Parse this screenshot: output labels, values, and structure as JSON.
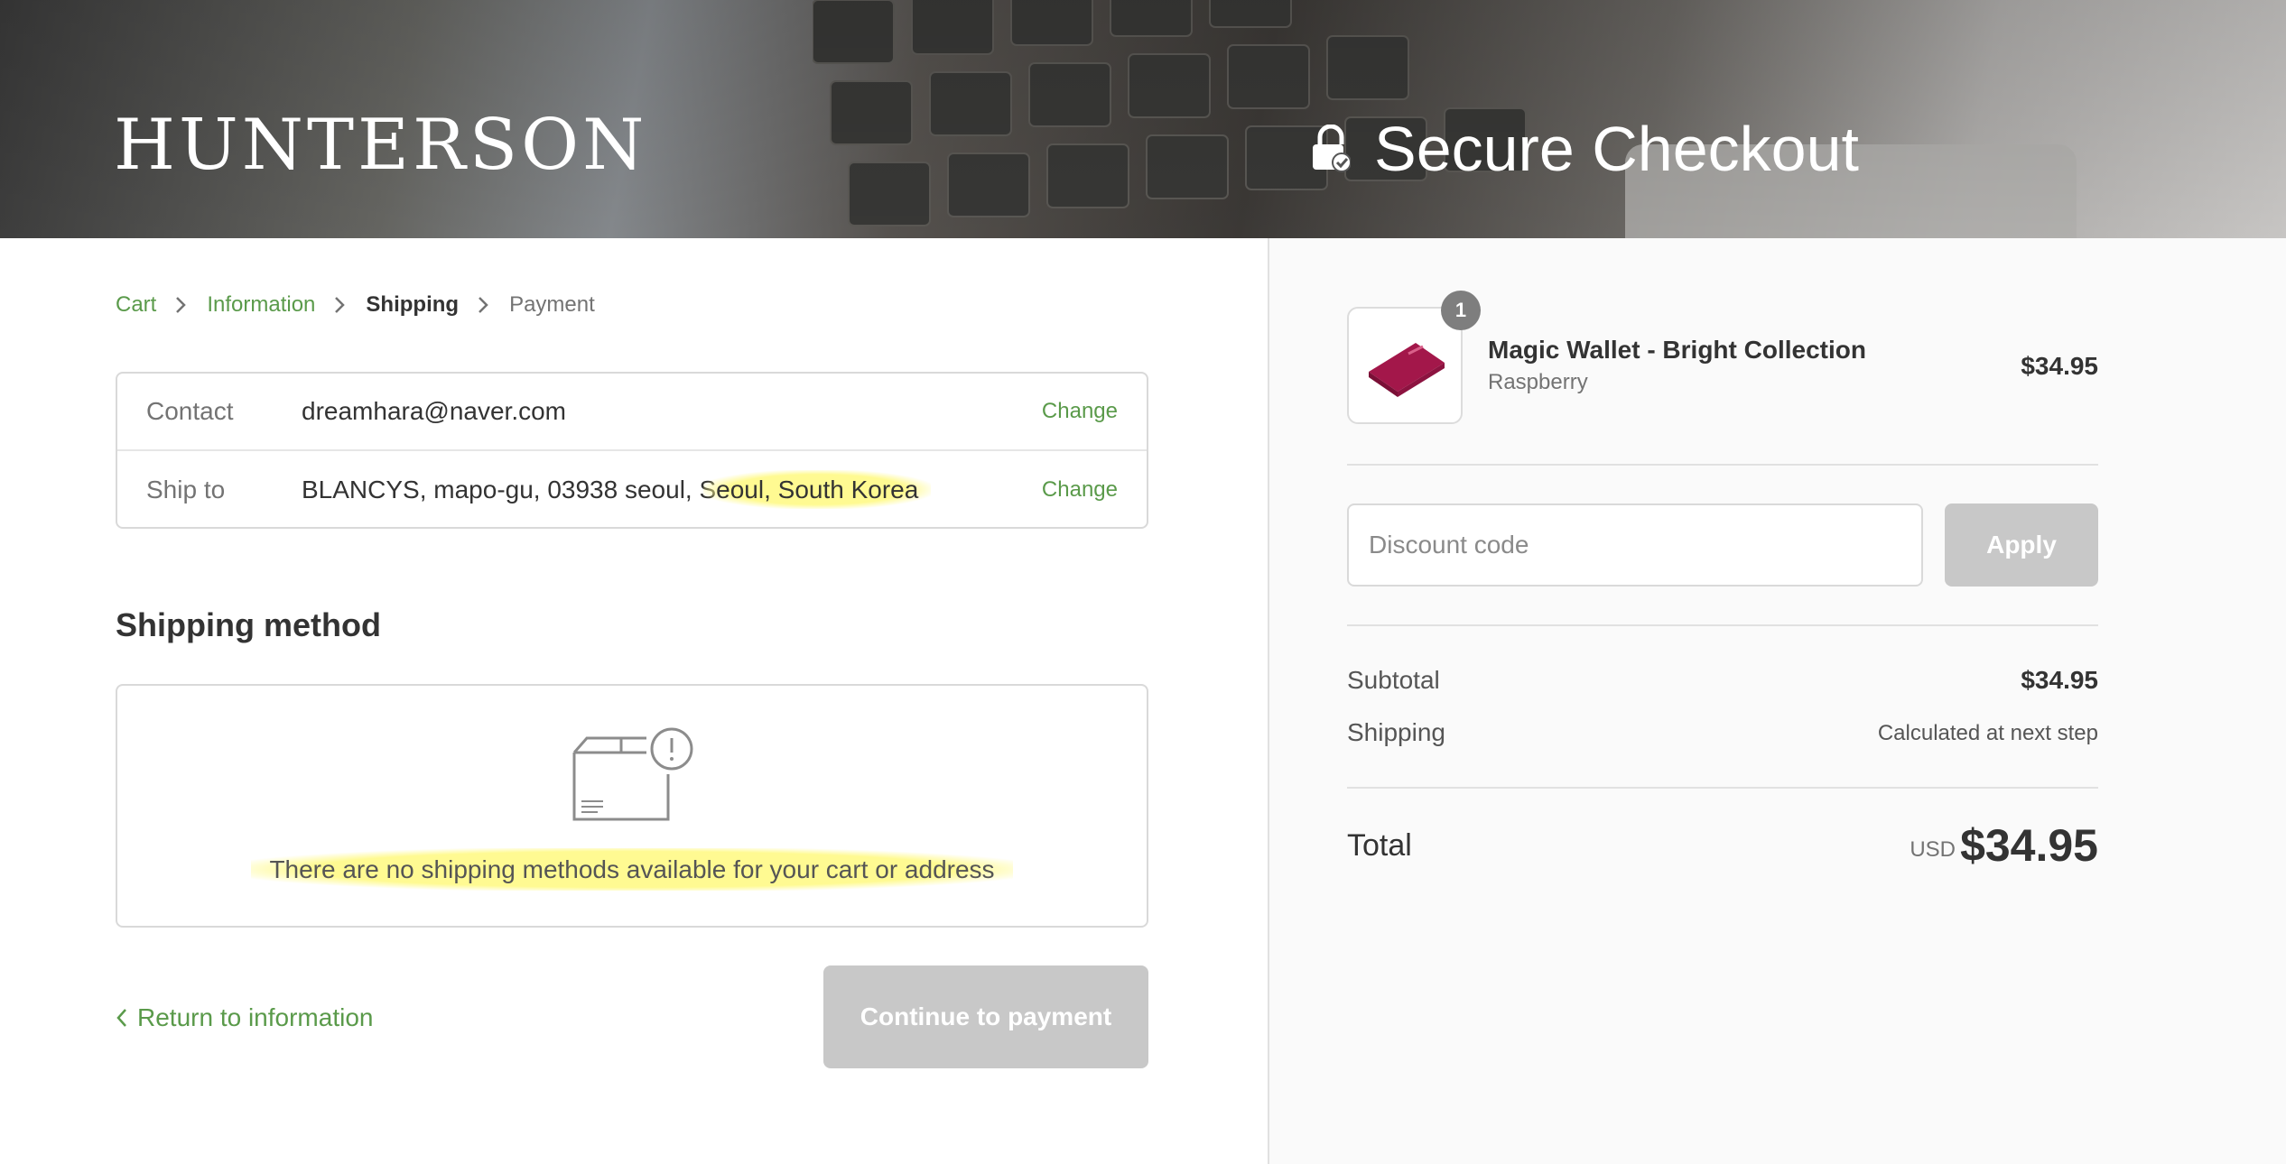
{
  "header": {
    "brand": "HUNTERSON",
    "secure_checkout": "Secure Checkout"
  },
  "breadcrumb": {
    "items": [
      "Cart",
      "Information",
      "Shipping",
      "Payment"
    ]
  },
  "review": {
    "contact_label": "Contact",
    "contact_value": "dreamhara@naver.com",
    "shipto_label": "Ship to",
    "shipto_value_a": "BLANCYS, mapo-gu, 03938 seoul, S",
    "shipto_value_b": "eoul, South Korea",
    "change_label": "Change"
  },
  "shipping": {
    "title": "Shipping method",
    "message": "There are no shipping methods available for your cart or address"
  },
  "nav": {
    "return_label": "Return to information",
    "continue_label": "Continue to payment"
  },
  "order": {
    "product": {
      "name": "Magic Wallet - Bright Collection",
      "variant": "Raspberry",
      "price": "$34.95",
      "quantity": "1"
    },
    "discount": {
      "placeholder": "Discount code",
      "apply_label": "Apply"
    },
    "subtotal_label": "Subtotal",
    "subtotal_value": "$34.95",
    "shipping_label": "Shipping",
    "shipping_value": "Calculated at next step",
    "total_label": "Total",
    "total_currency": "USD",
    "total_value": "$34.95"
  },
  "colors": {
    "accent": "#5a9a4a",
    "disabled_button": "#c8c8c8",
    "highlight": "#fffa8c",
    "product": "#a3174a"
  }
}
